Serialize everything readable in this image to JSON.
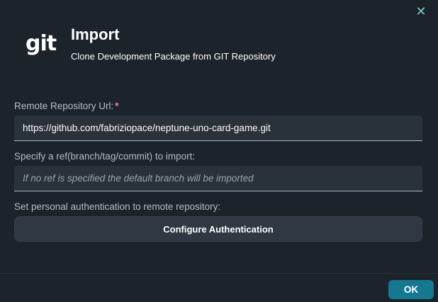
{
  "dialog": {
    "close_icon": "close-icon",
    "logo_text": "git",
    "title": "Import",
    "subtitle": "Clone Development Package from GIT Repository"
  },
  "form": {
    "repo_url": {
      "label": "Remote Repository Url:",
      "required_mark": "*",
      "value": "https://github.com/fabriziopace/neptune-uno-card-game.git"
    },
    "ref": {
      "label": "Specify a ref(branch/tag/commit) to import:",
      "placeholder": "If no ref is specified the default branch will be imported",
      "value": ""
    },
    "auth": {
      "label": "Set personal authentication to remote repository:",
      "button_label": "Configure Authentication"
    }
  },
  "footer": {
    "ok_label": "OK"
  },
  "colors": {
    "background": "#1d232a",
    "input_bg": "#29313a",
    "accent": "#157891",
    "required": "#f07ec0",
    "close_icon": "#7ec8d4"
  }
}
